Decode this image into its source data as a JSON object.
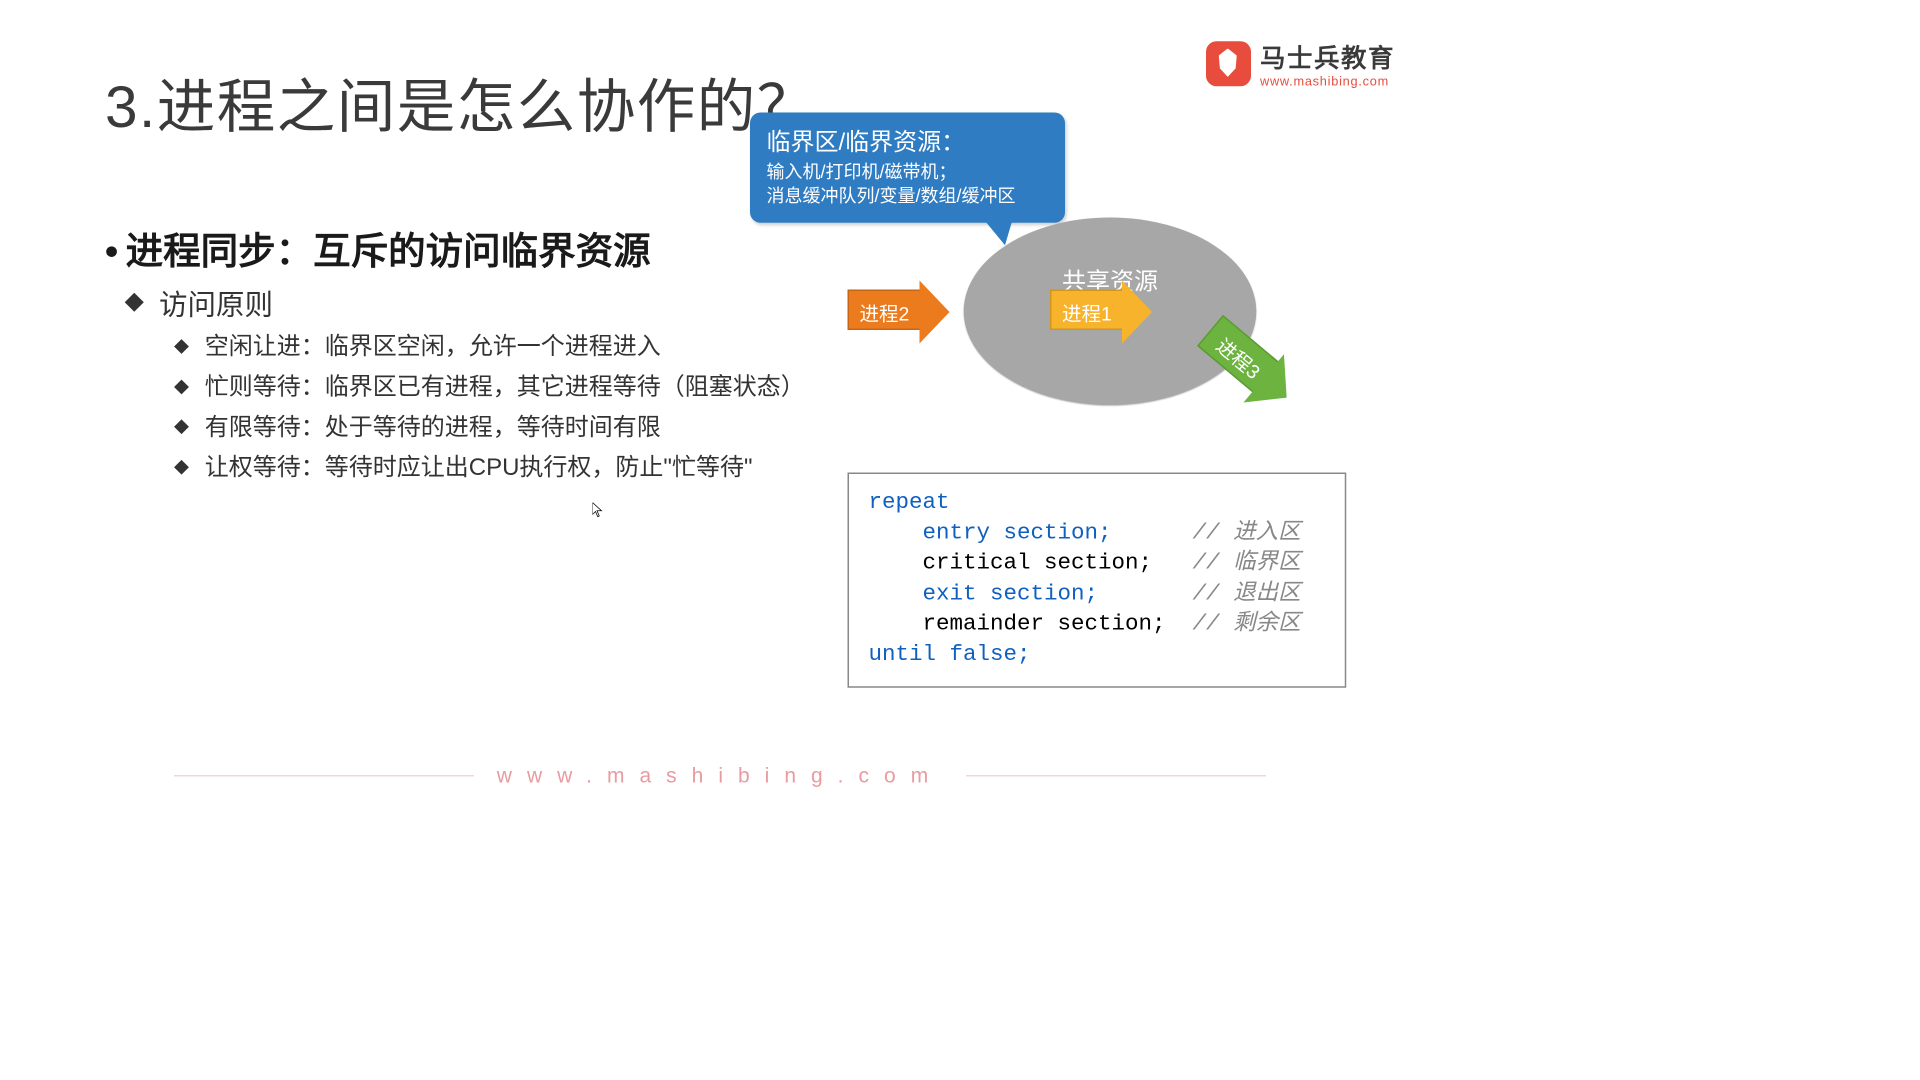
{
  "logo": {
    "title": "马士兵教育",
    "url": "www.mashibing.com"
  },
  "title": "3.进程之间是怎么协作的？",
  "subtitle": "进程同步：互斥的访问临界资源",
  "section_head": "访问原则",
  "rules": [
    "空闲让进：临界区空闲，允许一个进程进入",
    "忙则等待：临界区已有进程，其它进程等待（阻塞状态）",
    "有限等待：处于等待的进程，等待时间有限",
    "让权等待：等待时应让出CPU执行权，防止\"忙等待\""
  ],
  "callout": {
    "title": "临界区/临界资源：",
    "line1": "输入机/打印机/磁带机；",
    "line2": "消息缓冲队列/变量/数组/缓冲区"
  },
  "oval_label": "共享资源",
  "arrows": {
    "p1": "进程1",
    "p2": "进程2",
    "p3": "进程3"
  },
  "code": {
    "l1": "repeat",
    "l2a": "    entry section;      ",
    "l2c": "// 进入区",
    "l3a": "    critical section;   ",
    "l3c": "// 临界区",
    "l4a": "    exit section;       ",
    "l4c": "// 退出区",
    "l5a": "    remainder section;  ",
    "l5c": "// 剩余区",
    "l6": "until false;"
  },
  "footer": "www.mashibing.com"
}
